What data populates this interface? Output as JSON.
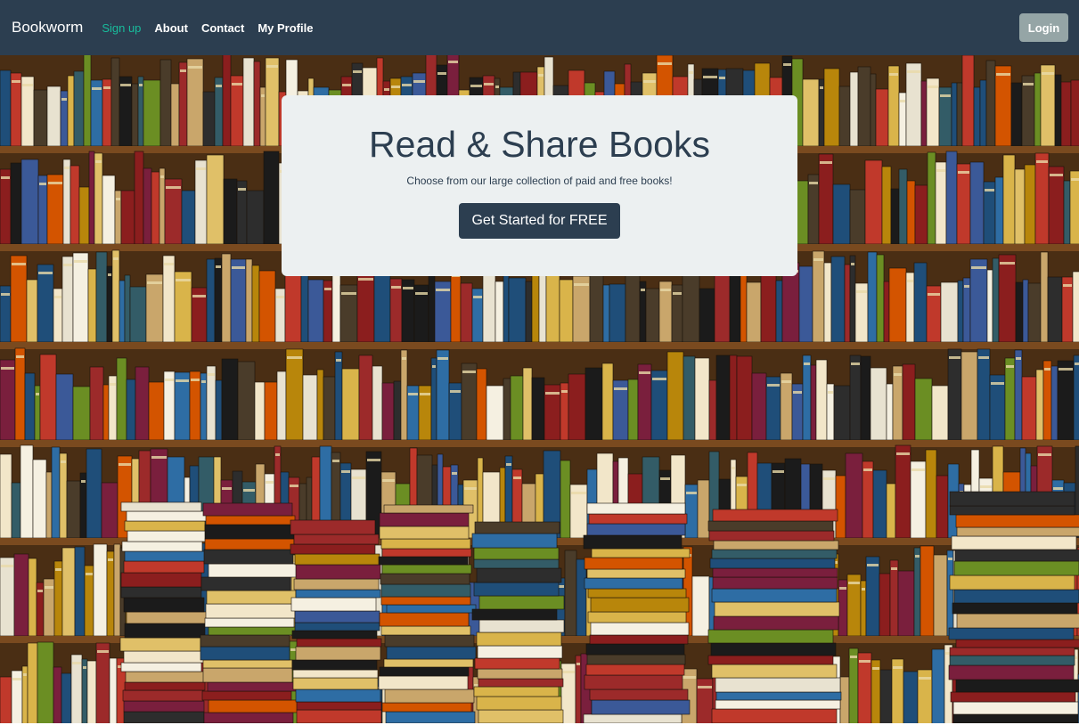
{
  "navbar": {
    "brand": "Bookworm",
    "links": [
      {
        "label": "Sign up",
        "active": true
      },
      {
        "label": "About",
        "active": false
      },
      {
        "label": "Contact",
        "active": false
      },
      {
        "label": "My Profile",
        "active": false
      }
    ],
    "login_label": "Login"
  },
  "hero": {
    "title": "Read & Share Books",
    "subtitle": "Choose from our large collection of paid and free books!",
    "cta_label": "Get Started for FREE",
    "background": "bookshelf-photo"
  },
  "colors": {
    "navbar_bg": "#2c3e50",
    "active_link": "#18bc9c",
    "login_bg": "#95a5a6",
    "jumbotron_bg": "#ecf0f1",
    "cta_bg": "#2c3e50"
  }
}
